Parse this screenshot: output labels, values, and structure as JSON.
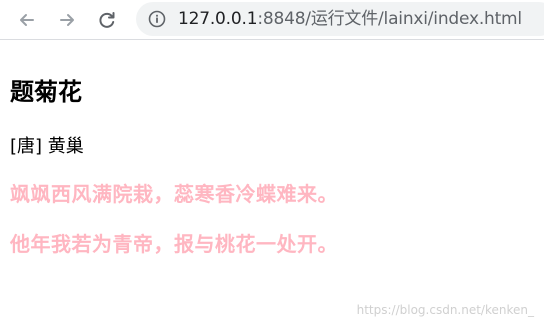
{
  "browser": {
    "url_host": "127.0.0.1",
    "url_rest": ":8848/运行文件/lainxi/index.html",
    "icons": {
      "back": "back-arrow-icon",
      "forward": "forward-arrow-icon",
      "reload": "reload-icon",
      "info": "info-icon"
    }
  },
  "poem": {
    "title": "题菊花",
    "author": "[唐] 黄巢",
    "lines": [
      "飒飒西风满院栽，蕊寒香冷蝶难来。",
      "他年我若为青帝，报与桃花一处开。"
    ],
    "line_color": "#ffb6c1"
  },
  "watermark": "https://blog.csdn.net/kenken_"
}
